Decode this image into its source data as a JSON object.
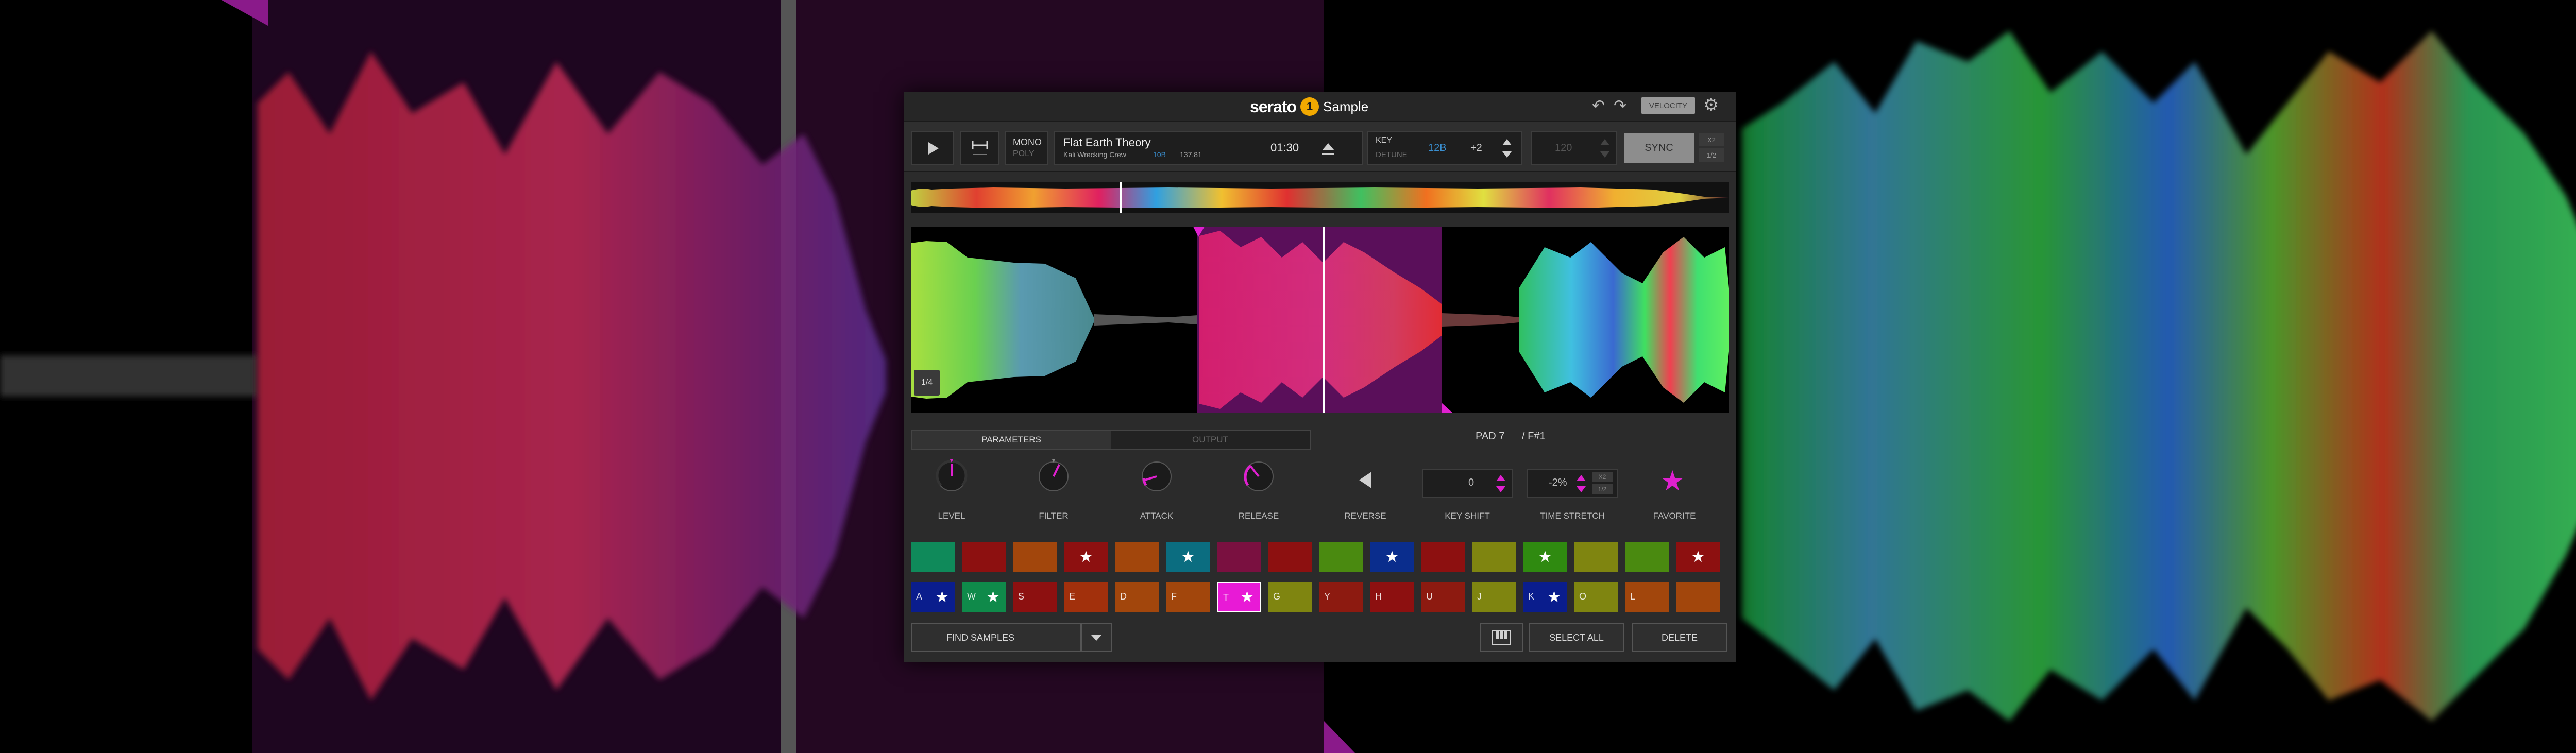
{
  "app": {
    "brand": "serato",
    "brand_badge": "1",
    "product": "Sample"
  },
  "toolbar": {
    "undo_icon": "undo-icon",
    "redo_icon": "redo-icon",
    "velocity_label": "VELOCITY",
    "settings_icon": "gear-icon"
  },
  "deck": {
    "mono_label": "MONO",
    "poly_label": "POLY",
    "track_title": "Flat Earth Theory",
    "track_artist": "Kali Wrecking Crew",
    "track_key": "10B",
    "track_bpm": "137.81",
    "track_time": "01:30",
    "key_label": "KEY",
    "detune_label": "DETUNE",
    "key_value": "12B",
    "key_offset": "+2",
    "bpm_value": "120",
    "sync_label": "SYNC",
    "x2_label": "X2",
    "half_label": "1/2"
  },
  "waveform": {
    "zoom_label": "1/4"
  },
  "params": {
    "tab_parameters": "PARAMETERS",
    "tab_output": "OUTPUT",
    "pad_title": "PAD 7",
    "pad_note": "/ F#1",
    "level_label": "LEVEL",
    "filter_label": "FILTER",
    "attack_label": "ATTACK",
    "release_label": "RELEASE",
    "reverse_label": "REVERSE",
    "key_shift_label": "KEY SHIFT",
    "key_shift_value": "0",
    "time_stretch_label": "TIME STRETCH",
    "time_stretch_value": "-2%",
    "favorite_label": "FAVORITE",
    "ts_x2": "X2",
    "ts_half": "1/2"
  },
  "pads_top": [
    {
      "color": "#0f8a5a",
      "star": false
    },
    {
      "color": "#8d1010",
      "star": false
    },
    {
      "color": "#a2460c",
      "star": false
    },
    {
      "color": "#8d1010",
      "star": true
    },
    {
      "color": "#a2460c",
      "star": false
    },
    {
      "color": "#0b6d80",
      "star": true
    },
    {
      "color": "#7a1040",
      "star": false
    },
    {
      "color": "#8d1010",
      "star": false
    },
    {
      "color": "#4a8a10",
      "star": false
    },
    {
      "color": "#0a2d8d",
      "star": true
    },
    {
      "color": "#8d1010",
      "star": false
    },
    {
      "color": "#7f8510",
      "star": false
    },
    {
      "color": "#2f8a10",
      "star": true
    },
    {
      "color": "#7f8510",
      "star": false
    },
    {
      "color": "#4a8a10",
      "star": false
    },
    {
      "color": "#8d1010",
      "star": true
    }
  ],
  "pads_bottom": [
    {
      "color": "#0a1d8d",
      "key": "A",
      "star": true
    },
    {
      "color": "#0f8a4a",
      "key": "W",
      "star": true
    },
    {
      "color": "#8d1010",
      "key": "S",
      "star": false
    },
    {
      "color": "#a2300c",
      "key": "E",
      "star": false
    },
    {
      "color": "#a2460c",
      "key": "D",
      "star": false
    },
    {
      "color": "#a2460c",
      "key": "F",
      "star": false
    },
    {
      "color": "#e81ad6",
      "key": "T",
      "star": true
    },
    {
      "color": "#7f8510",
      "key": "G",
      "star": false
    },
    {
      "color": "#8d1a10",
      "key": "Y",
      "star": false
    },
    {
      "color": "#8d1010",
      "key": "H",
      "star": false
    },
    {
      "color": "#8d1a10",
      "key": "U",
      "star": false
    },
    {
      "color": "#7f8510",
      "key": "J",
      "star": false
    },
    {
      "color": "#0a1d8d",
      "key": "K",
      "star": true
    },
    {
      "color": "#7f8510",
      "key": "O",
      "star": false
    },
    {
      "color": "#a2460c",
      "key": "L",
      "star": false
    },
    {
      "color": "#a2460c",
      "key": "",
      "star": false
    }
  ],
  "footer": {
    "find_samples": "FIND SAMPLES",
    "keyboard_icon": "piano-icon",
    "select_all": "SELECT ALL",
    "delete": "DELETE"
  },
  "colors": {
    "accent": "#e020d0",
    "selection": "#5a0f5a"
  }
}
